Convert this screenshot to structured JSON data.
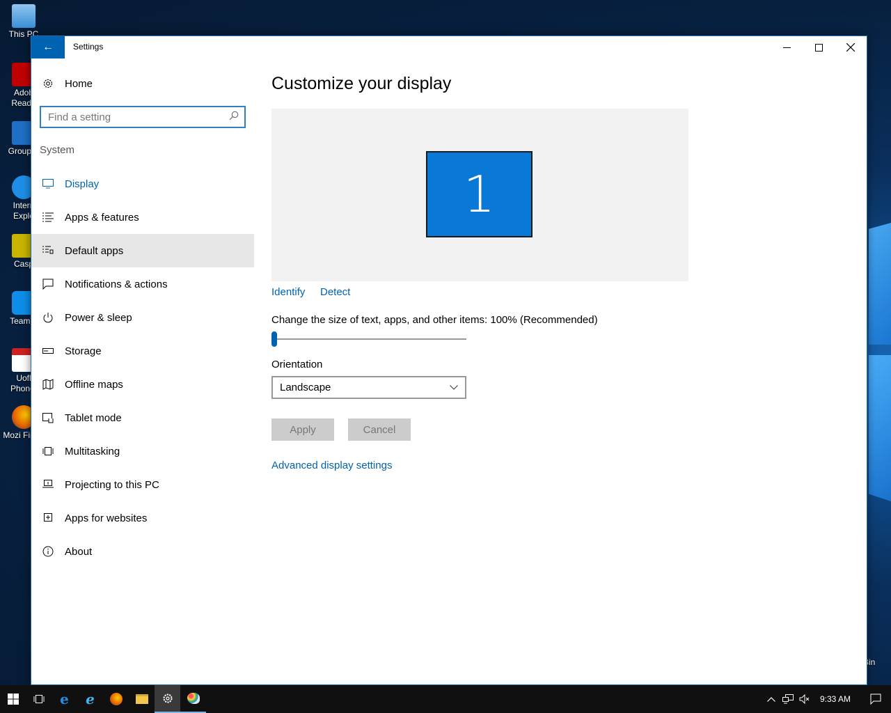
{
  "desktop": {
    "icons": [
      {
        "label": "This PC",
        "icon": "computer-icon",
        "color": "#3b8fd6"
      },
      {
        "label": "Adob Reade",
        "icon": "adobe-reader-icon",
        "color": "#c00000"
      },
      {
        "label": "GroupW",
        "icon": "groupwise-icon",
        "color": "#1f6fc6"
      },
      {
        "label": "Intern Explo",
        "icon": "internet-explorer-icon",
        "color": "#1f8ee6"
      },
      {
        "label": "Casp",
        "icon": "caspio-icon",
        "color": "#c9b400"
      },
      {
        "label": "TeamVi",
        "icon": "teamviewer-icon",
        "color": "#0e8ee9"
      },
      {
        "label": "Uofl Phonet",
        "icon": "pdf-file-icon",
        "color": "#cc2222"
      },
      {
        "label": "Mozi Firefo",
        "icon": "firefox-icon",
        "color": "#e66000"
      }
    ],
    "recycle_bin_label": "Bin"
  },
  "window": {
    "title": "Settings",
    "back_glyph": "←",
    "minimize_glyph": "—",
    "maximize_glyph": "☐",
    "close_glyph": "✕"
  },
  "nav": {
    "home_label": "Home",
    "search_placeholder": "Find a setting",
    "section": "System",
    "items": [
      {
        "label": "Display",
        "icon": "monitor-icon",
        "active": true
      },
      {
        "label": "Apps & features",
        "icon": "list-icon"
      },
      {
        "label": "Default apps",
        "icon": "default-apps-icon",
        "hover": true
      },
      {
        "label": "Notifications & actions",
        "icon": "notification-icon"
      },
      {
        "label": "Power & sleep",
        "icon": "power-icon"
      },
      {
        "label": "Storage",
        "icon": "storage-icon"
      },
      {
        "label": "Offline maps",
        "icon": "map-icon"
      },
      {
        "label": "Tablet mode",
        "icon": "tablet-icon"
      },
      {
        "label": "Multitasking",
        "icon": "multitasking-icon"
      },
      {
        "label": "Projecting to this PC",
        "icon": "projecting-icon"
      },
      {
        "label": "Apps for websites",
        "icon": "apps-websites-icon"
      },
      {
        "label": "About",
        "icon": "info-icon"
      }
    ]
  },
  "main": {
    "title": "Customize your display",
    "monitor_number": "1",
    "identify_label": "Identify",
    "detect_label": "Detect",
    "scale_label": "Change the size of text, apps, and other items: 100% (Recommended)",
    "scale_slider_level": 0,
    "orientation_label": "Orientation",
    "orientation_value": "Landscape",
    "apply_label": "Apply",
    "cancel_label": "Cancel",
    "advanced_label": "Advanced display settings"
  },
  "taskbar": {
    "clock": "9:33 AM",
    "apps": [
      "start-icon",
      "task-view-icon",
      "edge-icon",
      "internet-explorer-icon",
      "firefox-icon",
      "file-explorer-icon",
      "settings-icon",
      "paint-icon"
    ],
    "active_app": "settings-icon"
  },
  "colors": {
    "accent": "#0063b1",
    "monitor_fill": "#0a78d7",
    "taskbar": "#101010"
  }
}
